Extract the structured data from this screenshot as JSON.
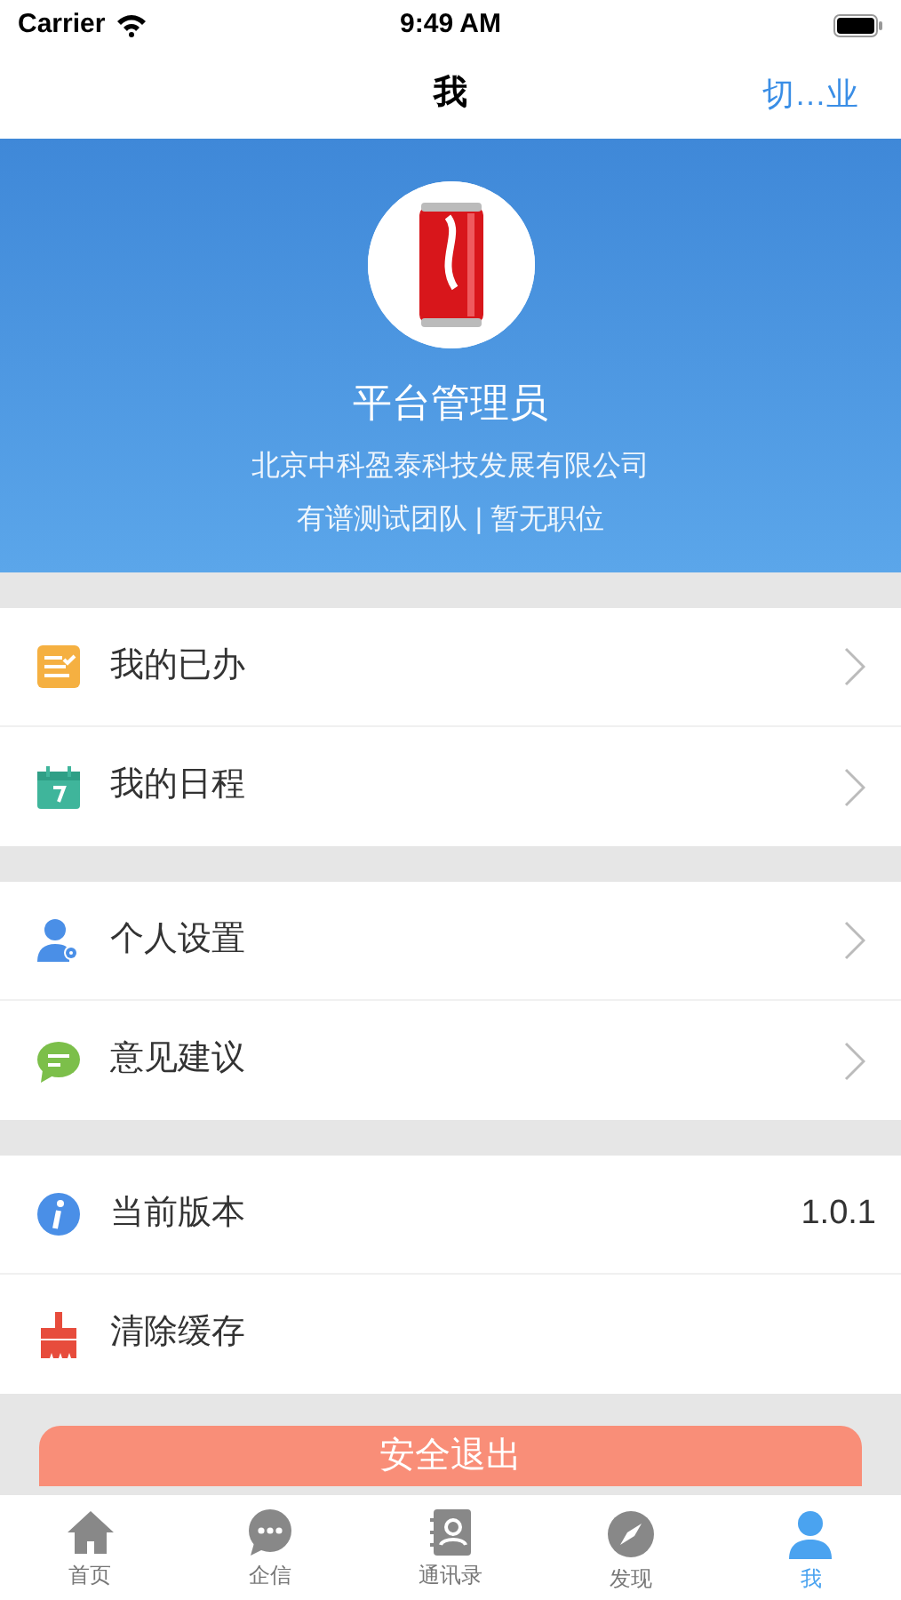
{
  "status_bar": {
    "carrier": "Carrier",
    "time": "9:49 AM"
  },
  "nav": {
    "title": "我",
    "action": "切…业"
  },
  "profile": {
    "name": "平台管理员",
    "company": "北京中科盈泰科技发展有限公司",
    "team": "有谱测试团队 | 暂无职位"
  },
  "sections": [
    {
      "items": [
        {
          "kind": "link",
          "label": "我的已办"
        },
        {
          "kind": "link",
          "label": "我的日程"
        }
      ]
    },
    {
      "items": [
        {
          "kind": "link",
          "label": "个人设置"
        },
        {
          "kind": "link",
          "label": "意见建议"
        }
      ]
    },
    {
      "items": [
        {
          "kind": "value",
          "label": "当前版本",
          "value": "1.0.1"
        },
        {
          "kind": "action",
          "label": "清除缓存"
        }
      ]
    }
  ],
  "logout_button": "安全退出",
  "tabs": [
    {
      "label": "首页",
      "selected": false
    },
    {
      "label": "企信",
      "selected": false
    },
    {
      "label": "通讯录",
      "selected": false
    },
    {
      "label": "发现",
      "selected": false
    },
    {
      "label": "我",
      "selected": true
    }
  ]
}
